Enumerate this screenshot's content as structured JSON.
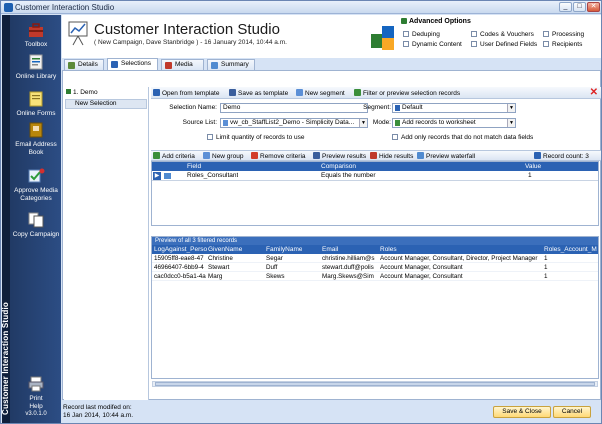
{
  "window": {
    "title": "Customer Interaction Studio",
    "controls": [
      "_",
      "□",
      "✕"
    ]
  },
  "sidebar": {
    "vertical_title": "Customer Interaction Studio",
    "items": [
      {
        "label": "Toolbox",
        "icon": "toolbox-icon"
      },
      {
        "label": "Online Library",
        "icon": "online-library-icon"
      },
      {
        "label": "Online Forms",
        "icon": "online-forms-icon"
      },
      {
        "label": "Email Address Book",
        "icon": "address-book-icon"
      },
      {
        "label": "Approve Media Categories",
        "icon": "approve-media-icon"
      },
      {
        "label": "Copy Campaign",
        "icon": "copy-campaign-icon"
      }
    ],
    "print_label": "Print",
    "help_label": "Help",
    "version": "v3.0.1.0"
  },
  "header": {
    "title": "Customer Interaction Studio",
    "subtitle": "( New Campaign, Dave Stanbridge ) - 16 January 2014, 10:44 a.m.",
    "advanced_title": "Advanced Options",
    "options": [
      "Deduping",
      "Codes & Vouchers",
      "Processing",
      "Dynamic Content",
      "User Defined Fields",
      "Recipients"
    ]
  },
  "tabs": [
    "Details",
    "Selections",
    "Media",
    "Summary"
  ],
  "tree": {
    "root": "1. Demo",
    "child": "New Selection"
  },
  "toolbar": {
    "open_template": "Open from template",
    "save_template": "Save as template",
    "new_segment": "New segment",
    "filter_preview": "Filter or preview selection records"
  },
  "form": {
    "selection_name_label": "Selection Name:",
    "selection_name_value": "Demo",
    "source_list_label": "Source List:",
    "source_list_value": "vw_cb_StaffList2_Demo - Simplicity Data...",
    "segment_label": "Segment:",
    "segment_value": "Default",
    "mode_label": "Mode:",
    "mode_value": "Add records to worksheet",
    "limit_label": "Limit quantity of records to use",
    "nomatch_label": "Add only records that do not match data fields"
  },
  "criteria_toolbar": {
    "add": "Add criteria",
    "new_group": "New group",
    "remove": "Remove criteria",
    "preview": "Preview results",
    "hide": "Hide results",
    "waterfall": "Preview waterfall",
    "record_count": "Record count: 3"
  },
  "criteria_grid": {
    "headers": [
      "Field",
      "Comparison",
      "Value"
    ],
    "rows": [
      {
        "field": "Roles_Consultant",
        "comparison": "Equals the number",
        "value": "1"
      }
    ]
  },
  "preview": {
    "title": "Preview of all 3 filtered records",
    "headers": [
      "LogAgainst_Perso",
      "GivenName",
      "FamilyName",
      "Email",
      "Roles",
      "Roles_Account_M"
    ],
    "rows": [
      [
        "15905ff8-eae8-47",
        "Christine",
        "Segar",
        "christine.hilliam@s",
        "Account Manager, Consultant, Director, Project Manager",
        "1"
      ],
      [
        "46966407-6bb9-4",
        "Stewart",
        "Duff",
        "stewart.duff@polis",
        "Account Manager, Consultant",
        "1"
      ],
      [
        "cac0dcc0-b5a1-4a",
        "Marg",
        "Skews",
        "Marg.Skews@Sim",
        "Account Manager, Consultant",
        "1"
      ]
    ]
  },
  "footer": {
    "record_modified_label": "Record last modifed on:",
    "record_modified_value": "16 Jan 2014, 10:44 a.m.",
    "save_close": "Save & Close",
    "cancel": "Cancel"
  }
}
